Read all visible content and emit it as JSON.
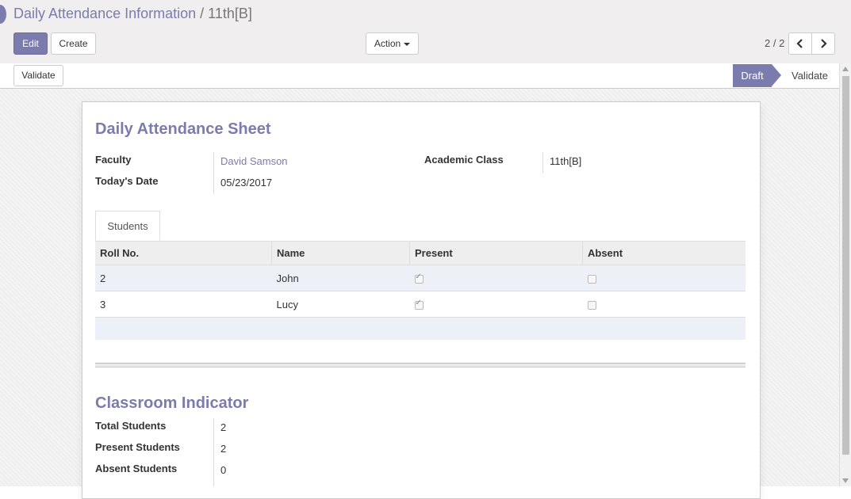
{
  "breadcrumb": {
    "parent": "Daily Attendance Information",
    "separator": "/",
    "current": "11th[B]"
  },
  "toolbar": {
    "edit_label": "Edit",
    "create_label": "Create",
    "action_label": "Action"
  },
  "pager": {
    "value": "2 / 2"
  },
  "statusbar": {
    "validate_button": "Validate",
    "stages": [
      "Draft",
      "Validate"
    ],
    "active_stage": "Draft"
  },
  "sheet": {
    "title": "Daily Attendance Sheet",
    "faculty_label": "Faculty",
    "faculty_value": "David Samson",
    "date_label": "Today's Date",
    "date_value": "05/23/2017",
    "class_label": "Academic Class",
    "class_value": "11th[B]"
  },
  "tabs": [
    "Students"
  ],
  "students_table": {
    "headers": [
      "Roll No.",
      "Name",
      "Present",
      "Absent"
    ],
    "rows": [
      {
        "roll": "2",
        "name": "John",
        "present": true,
        "absent": false
      },
      {
        "roll": "3",
        "name": "Lucy",
        "present": true,
        "absent": false
      }
    ]
  },
  "indicator": {
    "title": "Classroom Indicator",
    "total_label": "Total Students",
    "total_value": "2",
    "present_label": "Present Students",
    "present_value": "2",
    "absent_label": "Absent Students",
    "absent_value": "0"
  },
  "colors": {
    "accent": "#7c7bad",
    "panel_bg": "#f0eeee"
  }
}
